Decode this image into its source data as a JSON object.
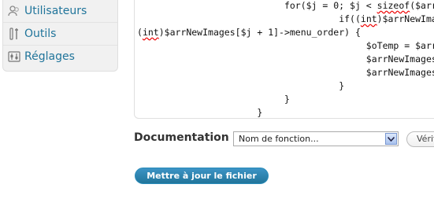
{
  "sidebar": {
    "items": [
      {
        "label": "Utilisateurs",
        "icon": "users-icon"
      },
      {
        "label": "Outils",
        "icon": "tools-icon"
      },
      {
        "label": "Réglages",
        "icon": "settings-icon"
      }
    ]
  },
  "editor": {
    "lines": [
      {
        "indent": "                           ",
        "pre": "for($j = 0; $j < ",
        "squig": "sizeof",
        "post": "($arrNe"
      },
      {
        "indent": "                                     ",
        "pre": "if((",
        "squig": "int",
        "post": ")$arrNewImages["
      },
      {
        "indent": "",
        "pre": "(",
        "squig": "int",
        "post": ")$arrNewImages[$j + 1]->menu_order) {"
      },
      {
        "indent": "                                          ",
        "pre": "$oTemp = $arrN",
        "squig": "",
        "post": ""
      },
      {
        "indent": "                                          ",
        "pre": "$arrNewImages[",
        "squig": "",
        "post": ""
      },
      {
        "indent": "                                          ",
        "pre": "$arrNewImages[",
        "squig": "",
        "post": ""
      },
      {
        "indent": "                                     ",
        "pre": "}",
        "squig": "",
        "post": ""
      },
      {
        "indent": "                           ",
        "pre": "}",
        "squig": "",
        "post": ""
      },
      {
        "indent": "                      ",
        "pre": "}",
        "squig": "",
        "post": ""
      }
    ]
  },
  "documentation": {
    "label": "Documentation :",
    "select_value": "Nom de fonction...",
    "lookup_button": "Vérifier"
  },
  "submit": {
    "label": "Mettre à jour le fichier"
  },
  "colors": {
    "link": "#21759b",
    "primary": "#21759b"
  }
}
